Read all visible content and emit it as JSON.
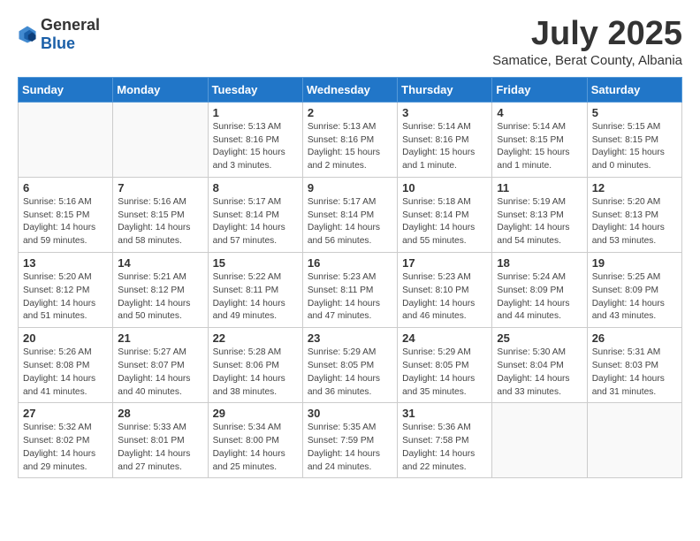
{
  "logo": {
    "general": "General",
    "blue": "Blue"
  },
  "title": "July 2025",
  "subtitle": "Samatice, Berat County, Albania",
  "days_of_week": [
    "Sunday",
    "Monday",
    "Tuesday",
    "Wednesday",
    "Thursday",
    "Friday",
    "Saturday"
  ],
  "weeks": [
    [
      {
        "day": "",
        "info": ""
      },
      {
        "day": "",
        "info": ""
      },
      {
        "day": "1",
        "info": "Sunrise: 5:13 AM\nSunset: 8:16 PM\nDaylight: 15 hours and 3 minutes."
      },
      {
        "day": "2",
        "info": "Sunrise: 5:13 AM\nSunset: 8:16 PM\nDaylight: 15 hours and 2 minutes."
      },
      {
        "day": "3",
        "info": "Sunrise: 5:14 AM\nSunset: 8:16 PM\nDaylight: 15 hours and 1 minute."
      },
      {
        "day": "4",
        "info": "Sunrise: 5:14 AM\nSunset: 8:15 PM\nDaylight: 15 hours and 1 minute."
      },
      {
        "day": "5",
        "info": "Sunrise: 5:15 AM\nSunset: 8:15 PM\nDaylight: 15 hours and 0 minutes."
      }
    ],
    [
      {
        "day": "6",
        "info": "Sunrise: 5:16 AM\nSunset: 8:15 PM\nDaylight: 14 hours and 59 minutes."
      },
      {
        "day": "7",
        "info": "Sunrise: 5:16 AM\nSunset: 8:15 PM\nDaylight: 14 hours and 58 minutes."
      },
      {
        "day": "8",
        "info": "Sunrise: 5:17 AM\nSunset: 8:14 PM\nDaylight: 14 hours and 57 minutes."
      },
      {
        "day": "9",
        "info": "Sunrise: 5:17 AM\nSunset: 8:14 PM\nDaylight: 14 hours and 56 minutes."
      },
      {
        "day": "10",
        "info": "Sunrise: 5:18 AM\nSunset: 8:14 PM\nDaylight: 14 hours and 55 minutes."
      },
      {
        "day": "11",
        "info": "Sunrise: 5:19 AM\nSunset: 8:13 PM\nDaylight: 14 hours and 54 minutes."
      },
      {
        "day": "12",
        "info": "Sunrise: 5:20 AM\nSunset: 8:13 PM\nDaylight: 14 hours and 53 minutes."
      }
    ],
    [
      {
        "day": "13",
        "info": "Sunrise: 5:20 AM\nSunset: 8:12 PM\nDaylight: 14 hours and 51 minutes."
      },
      {
        "day": "14",
        "info": "Sunrise: 5:21 AM\nSunset: 8:12 PM\nDaylight: 14 hours and 50 minutes."
      },
      {
        "day": "15",
        "info": "Sunrise: 5:22 AM\nSunset: 8:11 PM\nDaylight: 14 hours and 49 minutes."
      },
      {
        "day": "16",
        "info": "Sunrise: 5:23 AM\nSunset: 8:11 PM\nDaylight: 14 hours and 47 minutes."
      },
      {
        "day": "17",
        "info": "Sunrise: 5:23 AM\nSunset: 8:10 PM\nDaylight: 14 hours and 46 minutes."
      },
      {
        "day": "18",
        "info": "Sunrise: 5:24 AM\nSunset: 8:09 PM\nDaylight: 14 hours and 44 minutes."
      },
      {
        "day": "19",
        "info": "Sunrise: 5:25 AM\nSunset: 8:09 PM\nDaylight: 14 hours and 43 minutes."
      }
    ],
    [
      {
        "day": "20",
        "info": "Sunrise: 5:26 AM\nSunset: 8:08 PM\nDaylight: 14 hours and 41 minutes."
      },
      {
        "day": "21",
        "info": "Sunrise: 5:27 AM\nSunset: 8:07 PM\nDaylight: 14 hours and 40 minutes."
      },
      {
        "day": "22",
        "info": "Sunrise: 5:28 AM\nSunset: 8:06 PM\nDaylight: 14 hours and 38 minutes."
      },
      {
        "day": "23",
        "info": "Sunrise: 5:29 AM\nSunset: 8:05 PM\nDaylight: 14 hours and 36 minutes."
      },
      {
        "day": "24",
        "info": "Sunrise: 5:29 AM\nSunset: 8:05 PM\nDaylight: 14 hours and 35 minutes."
      },
      {
        "day": "25",
        "info": "Sunrise: 5:30 AM\nSunset: 8:04 PM\nDaylight: 14 hours and 33 minutes."
      },
      {
        "day": "26",
        "info": "Sunrise: 5:31 AM\nSunset: 8:03 PM\nDaylight: 14 hours and 31 minutes."
      }
    ],
    [
      {
        "day": "27",
        "info": "Sunrise: 5:32 AM\nSunset: 8:02 PM\nDaylight: 14 hours and 29 minutes."
      },
      {
        "day": "28",
        "info": "Sunrise: 5:33 AM\nSunset: 8:01 PM\nDaylight: 14 hours and 27 minutes."
      },
      {
        "day": "29",
        "info": "Sunrise: 5:34 AM\nSunset: 8:00 PM\nDaylight: 14 hours and 25 minutes."
      },
      {
        "day": "30",
        "info": "Sunrise: 5:35 AM\nSunset: 7:59 PM\nDaylight: 14 hours and 24 minutes."
      },
      {
        "day": "31",
        "info": "Sunrise: 5:36 AM\nSunset: 7:58 PM\nDaylight: 14 hours and 22 minutes."
      },
      {
        "day": "",
        "info": ""
      },
      {
        "day": "",
        "info": ""
      }
    ]
  ]
}
